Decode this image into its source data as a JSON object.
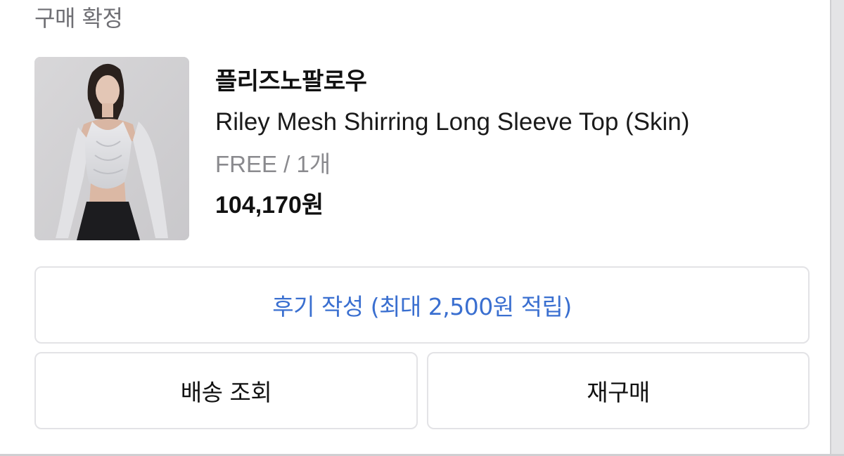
{
  "order": {
    "status_title": "구매 확정"
  },
  "product": {
    "brand": "플리즈노팔로우",
    "name": "Riley Mesh Shirring Long Sleeve Top (Skin)",
    "option": "FREE / 1개",
    "price": "104,170원",
    "image_icon": "product-photo"
  },
  "actions": {
    "review_label": "후기 작성 (최대 2,500원 적립)",
    "delivery_label": "배송 조회",
    "rebuy_label": "재구매"
  },
  "colors": {
    "accent": "#3a6fd0",
    "border": "#e3e3e6",
    "muted_text": "#8a8a8e"
  }
}
